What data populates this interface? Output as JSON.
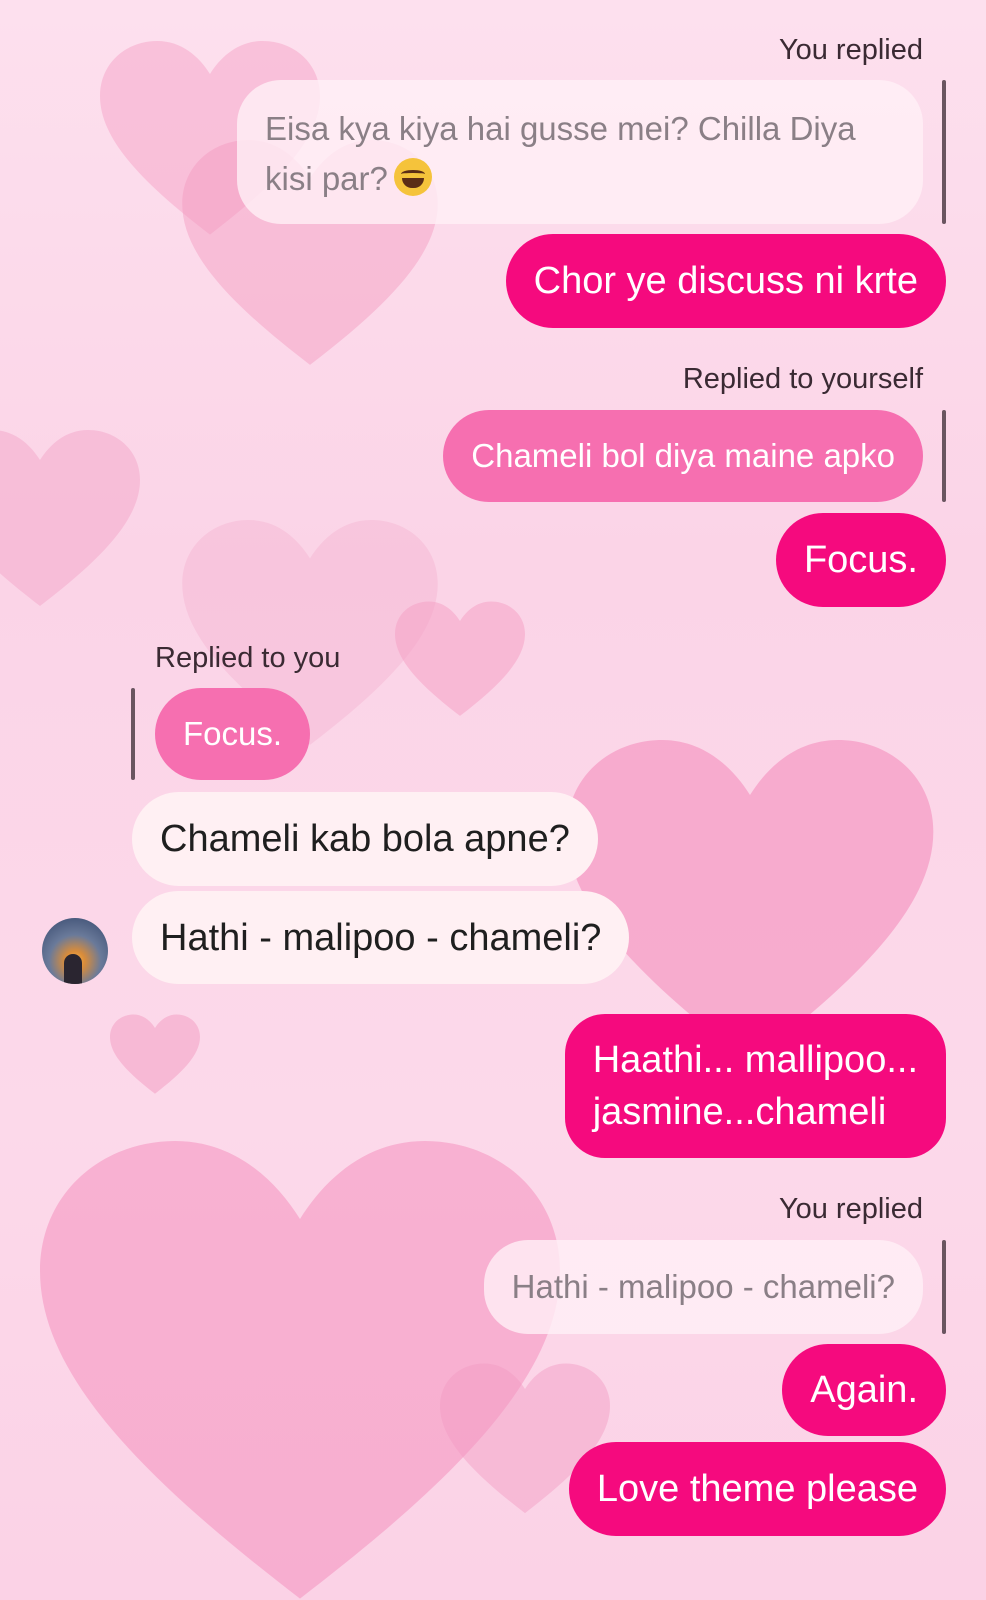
{
  "colors": {
    "sent_bubble": "#f50a7e",
    "quoted_bubble": "#f66fb0",
    "received_bubble": "#fff0f3",
    "background": "#fbd4e7"
  },
  "theme": {
    "background_icon": "heart-icon"
  },
  "messages": [
    {
      "kind": "reply_label",
      "side": "right",
      "text": "You replied"
    },
    {
      "kind": "quoted",
      "side": "right",
      "text": "Eisa kya kiya hai gusse mei? Chilla Diya\nkisi par?",
      "emoji": "face-with-tears-of-joy"
    },
    {
      "kind": "sent",
      "text": "Chor ye discuss ni krte"
    },
    {
      "kind": "reply_label",
      "side": "right",
      "text": "Replied to yourself"
    },
    {
      "kind": "quoted",
      "side": "right",
      "text": "Chameli bol diya maine apko"
    },
    {
      "kind": "sent",
      "text": "Focus."
    },
    {
      "kind": "reply_label",
      "side": "left",
      "text": "Replied to you"
    },
    {
      "kind": "quoted",
      "side": "left",
      "text": "Focus."
    },
    {
      "kind": "received",
      "text": "Chameli kab bola apne?"
    },
    {
      "kind": "received",
      "text": "Hathi - malipoo - chameli?"
    },
    {
      "kind": "sent",
      "text": "Haathi... mallipoo...\njasmine...chameli"
    },
    {
      "kind": "reply_label",
      "side": "right",
      "text": "You replied"
    },
    {
      "kind": "quoted",
      "side": "right",
      "text": "Hathi - malipoo - chameli?"
    },
    {
      "kind": "sent",
      "text": "Again."
    },
    {
      "kind": "sent",
      "text": "Love theme please"
    }
  ]
}
